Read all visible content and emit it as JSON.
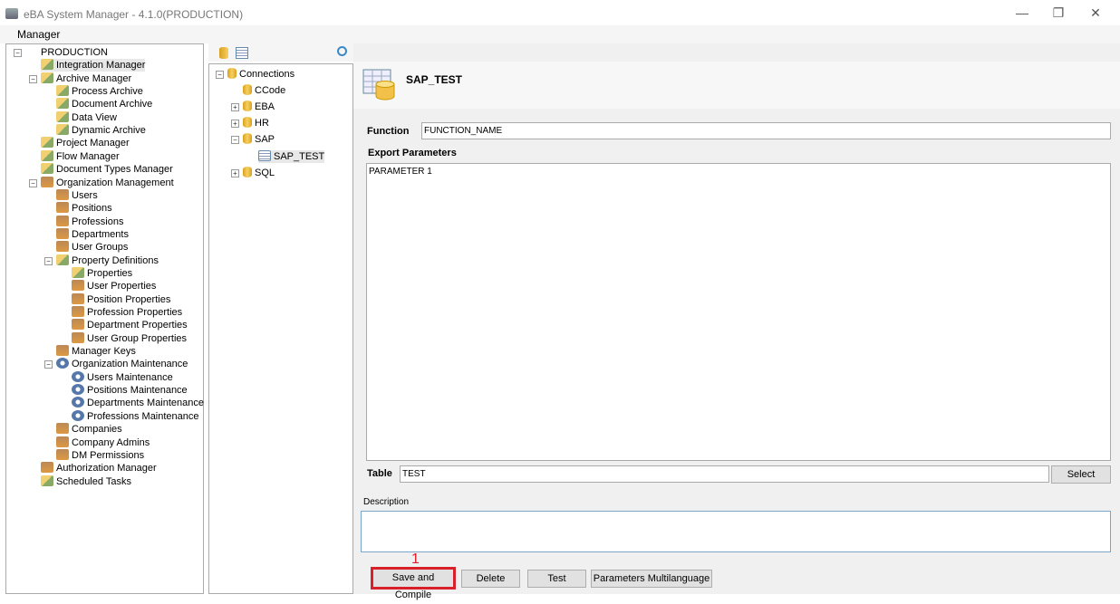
{
  "window": {
    "title": "eBA System Manager - 4.1.0(PRODUCTION)",
    "minimize": "—",
    "restore": "❐",
    "close": "✕"
  },
  "menu": {
    "manager": "Manager"
  },
  "left_tree": [
    {
      "label": "PRODUCTION",
      "level": 0,
      "icon": "server",
      "exp": "−"
    },
    {
      "label": "Integration Manager",
      "level": 1,
      "icon": "mgr",
      "selected": true
    },
    {
      "label": "Archive Manager",
      "level": 1,
      "icon": "mgr",
      "exp": "−"
    },
    {
      "label": "Process Archive",
      "level": 2,
      "icon": "mgr"
    },
    {
      "label": "Document Archive",
      "level": 2,
      "icon": "mgr"
    },
    {
      "label": "Data View",
      "level": 2,
      "icon": "mgr"
    },
    {
      "label": "Dynamic Archive",
      "level": 2,
      "icon": "mgr"
    },
    {
      "label": "Project Manager",
      "level": 1,
      "icon": "mgr"
    },
    {
      "label": "Flow Manager",
      "level": 1,
      "icon": "mgr"
    },
    {
      "label": "Document Types Manager",
      "level": 1,
      "icon": "mgr"
    },
    {
      "label": "Organization Management",
      "level": 1,
      "icon": "org",
      "exp": "−"
    },
    {
      "label": "Users",
      "level": 2,
      "icon": "org"
    },
    {
      "label": "Positions",
      "level": 2,
      "icon": "org"
    },
    {
      "label": "Professions",
      "level": 2,
      "icon": "org"
    },
    {
      "label": "Departments",
      "level": 2,
      "icon": "org"
    },
    {
      "label": "User Groups",
      "level": 2,
      "icon": "org"
    },
    {
      "label": "Property Definitions",
      "level": 2,
      "icon": "mgr",
      "exp": "−"
    },
    {
      "label": "Properties",
      "level": 3,
      "icon": "mgr"
    },
    {
      "label": "User Properties",
      "level": 3,
      "icon": "org"
    },
    {
      "label": "Position Properties",
      "level": 3,
      "icon": "org"
    },
    {
      "label": "Profession Properties",
      "level": 3,
      "icon": "org"
    },
    {
      "label": "Department Properties",
      "level": 3,
      "icon": "org"
    },
    {
      "label": "User Group Properties",
      "level": 3,
      "icon": "org"
    },
    {
      "label": "Manager Keys",
      "level": 2,
      "icon": "org"
    },
    {
      "label": "Organization Maintenance",
      "level": 2,
      "icon": "gear",
      "exp": "−"
    },
    {
      "label": "Users Maintenance",
      "level": 3,
      "icon": "gear"
    },
    {
      "label": "Positions Maintenance",
      "level": 3,
      "icon": "gear"
    },
    {
      "label": "Departments Maintenance",
      "level": 3,
      "icon": "gear"
    },
    {
      "label": "Professions Maintenance",
      "level": 3,
      "icon": "gear"
    },
    {
      "label": "Companies",
      "level": 2,
      "icon": "org"
    },
    {
      "label": "Company Admins",
      "level": 2,
      "icon": "org"
    },
    {
      "label": "DM Permissions",
      "level": 2,
      "icon": "org"
    },
    {
      "label": "Authorization Manager",
      "level": 1,
      "icon": "org"
    },
    {
      "label": "Scheduled Tasks",
      "level": 1,
      "icon": "mgr"
    }
  ],
  "connections_tree": [
    {
      "label": "Connections",
      "level": 0,
      "icon": "db",
      "exp": "−"
    },
    {
      "label": "CCode",
      "level": 1,
      "icon": "db"
    },
    {
      "label": "EBA",
      "level": 1,
      "icon": "db",
      "exp": "+"
    },
    {
      "label": "HR",
      "level": 1,
      "icon": "db",
      "exp": "+"
    },
    {
      "label": "SAP",
      "level": 1,
      "icon": "db",
      "exp": "−"
    },
    {
      "label": "SAP_TEST",
      "level": 2,
      "icon": "tbl",
      "selected": true
    },
    {
      "label": "SQL",
      "level": 1,
      "icon": "db",
      "exp": "+"
    }
  ],
  "detail": {
    "title": "SAP_TEST",
    "function_label": "Function",
    "function_value": "FUNCTION_NAME",
    "export_label": "Export Parameters",
    "export_value": "PARAMETER 1",
    "table_label": "Table",
    "table_value": "TEST",
    "select_button": "Select",
    "description_label": "Description",
    "description_value": "",
    "buttons": {
      "save": "Save and Compile",
      "delete": "Delete",
      "test": "Test",
      "multilang": "Parameters Multilanguage"
    },
    "marker": "1"
  },
  "colors": {
    "highlight": "#d9202a"
  }
}
